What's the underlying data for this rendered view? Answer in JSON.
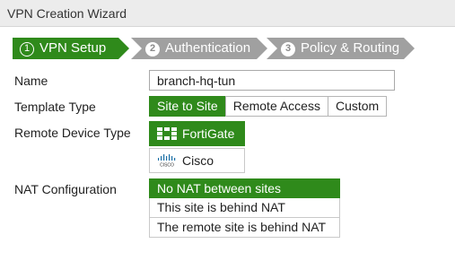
{
  "window": {
    "title": "VPN Creation Wizard"
  },
  "steps": [
    {
      "number": "1",
      "label": "VPN Setup",
      "state": "active"
    },
    {
      "number": "2",
      "label": "Authentication",
      "state": "inactive"
    },
    {
      "number": "3",
      "label": "Policy & Routing",
      "state": "inactive"
    }
  ],
  "form": {
    "name_label": "Name",
    "name_value": "branch-hq-tun",
    "template_label": "Template Type",
    "template_options": [
      "Site to Site",
      "Remote Access",
      "Custom"
    ],
    "template_selected": "Site to Site",
    "remote_device_label": "Remote Device Type",
    "remote_device_options": [
      {
        "label": "FortiGate",
        "icon": "fortigate-icon",
        "selected": true
      },
      {
        "label": "Cisco",
        "icon": "cisco-icon",
        "selected": false
      }
    ],
    "nat_label": "NAT Configuration",
    "nat_options": [
      "No NAT between sites",
      "This site is behind NAT",
      "The remote site is behind NAT"
    ],
    "nat_selected": "No NAT between sites"
  },
  "colors": {
    "accent": "#2f8a1b",
    "inactive_step": "#a0a0a0"
  }
}
